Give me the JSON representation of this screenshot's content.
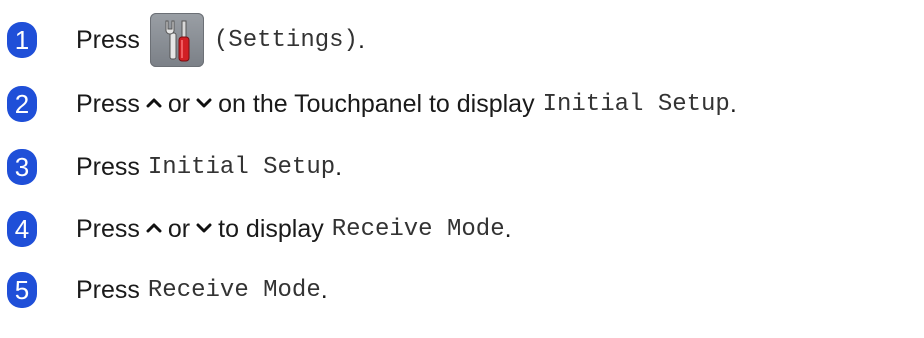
{
  "steps": [
    {
      "number": "1",
      "parts": {
        "p1": "Press",
        "code": "(Settings)",
        "end": "."
      }
    },
    {
      "number": "2",
      "parts": {
        "p1": "Press",
        "or": "or",
        "p2": "on the Touchpanel to display",
        "code": "Initial Setup",
        "end": "."
      }
    },
    {
      "number": "3",
      "parts": {
        "p1": "Press",
        "code": "Initial Setup",
        "end": "."
      }
    },
    {
      "number": "4",
      "parts": {
        "p1": "Press",
        "or": "or",
        "p2": "to display",
        "code": "Receive Mode",
        "end": "."
      }
    },
    {
      "number": "5",
      "parts": {
        "p1": "Press",
        "code": "Receive Mode",
        "end": "."
      }
    }
  ],
  "icons": {
    "settings": "settings-wrench-screwdriver-icon",
    "up": "chevron-up-icon",
    "down": "chevron-down-icon"
  },
  "colors": {
    "badge": "#1f4fd8",
    "text": "#1a1a1a",
    "settings_button": "#8a8f96"
  }
}
